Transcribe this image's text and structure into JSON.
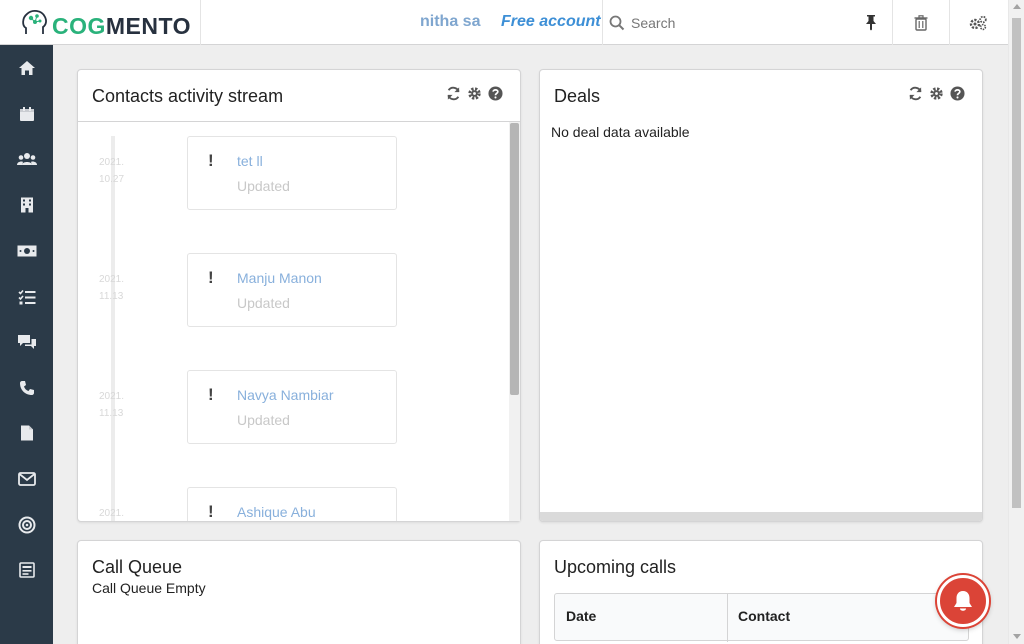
{
  "header": {
    "logo_part1": "COG",
    "logo_part2": "MENTO",
    "user_name": "nitha sa",
    "account_label": "Free account",
    "search_placeholder": "Search"
  },
  "sidebar": {
    "items": [
      {
        "icon": "home-icon"
      },
      {
        "icon": "calendar-icon"
      },
      {
        "icon": "contacts-icon"
      },
      {
        "icon": "companies-icon"
      },
      {
        "icon": "deals-icon"
      },
      {
        "icon": "tasks-icon"
      },
      {
        "icon": "cases-icon"
      },
      {
        "icon": "calls-icon"
      },
      {
        "icon": "documents-icon"
      },
      {
        "icon": "email-icon"
      },
      {
        "icon": "campaigns-icon"
      },
      {
        "icon": "forms-icon"
      }
    ]
  },
  "activity": {
    "title": "Contacts activity stream",
    "items": [
      {
        "date_line1": "2021.",
        "date_line2": "10.27",
        "name": "tet ll",
        "status": "Updated"
      },
      {
        "date_line1": "2021.",
        "date_line2": "11.13",
        "name": "Manju Manon",
        "status": "Updated"
      },
      {
        "date_line1": "2021.",
        "date_line2": "11.13",
        "name": "Navya Nambiar",
        "status": "Updated"
      },
      {
        "date_line1": "2021.",
        "date_line2": "",
        "name": "Ashique Abu",
        "status": ""
      }
    ]
  },
  "deals": {
    "title": "Deals",
    "empty_text": "No deal data available"
  },
  "call_queue": {
    "title": "Call Queue",
    "empty_text": "Call Queue Empty"
  },
  "upcoming_calls": {
    "title": "Upcoming calls",
    "columns": [
      "Date",
      "Contact"
    ]
  },
  "colors": {
    "sidebar_bg": "#2b3a48",
    "logo_green": "#2ab27b",
    "logo_dark": "#27313f",
    "link_blue": "#3d8fd6",
    "alert_red": "#db4437"
  }
}
